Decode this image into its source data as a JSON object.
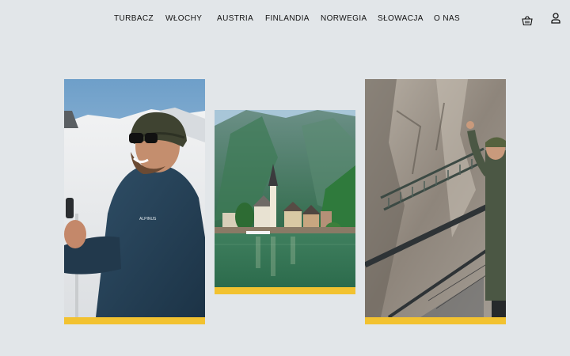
{
  "nav": {
    "items": [
      {
        "label": "TURBACZ"
      },
      {
        "label": "WŁOCHY"
      },
      {
        "label": "AUSTRIA"
      },
      {
        "label": "FINLANDIA"
      },
      {
        "label": "NORWEGIA"
      },
      {
        "label": "SŁOWACJA"
      },
      {
        "label": "O NAS"
      }
    ],
    "cart_icon": "basket-icon",
    "account_icon": "user-icon"
  },
  "gallery": {
    "cards": [
      {
        "subject": "Smiling hiker with beanie and sunglasses holding trekking poles in snowy mountains",
        "jacket_text": "ALPINUS"
      },
      {
        "subject": "Hallstatt lakeside village with church spire beneath green mountains"
      },
      {
        "subject": "Climber on via ferrata steel cable ladder and suspension bridge on rock face"
      }
    ]
  },
  "colors": {
    "background": "#e2e6e9",
    "accent_bar": "#f2c230",
    "nav_text": "#111111"
  }
}
